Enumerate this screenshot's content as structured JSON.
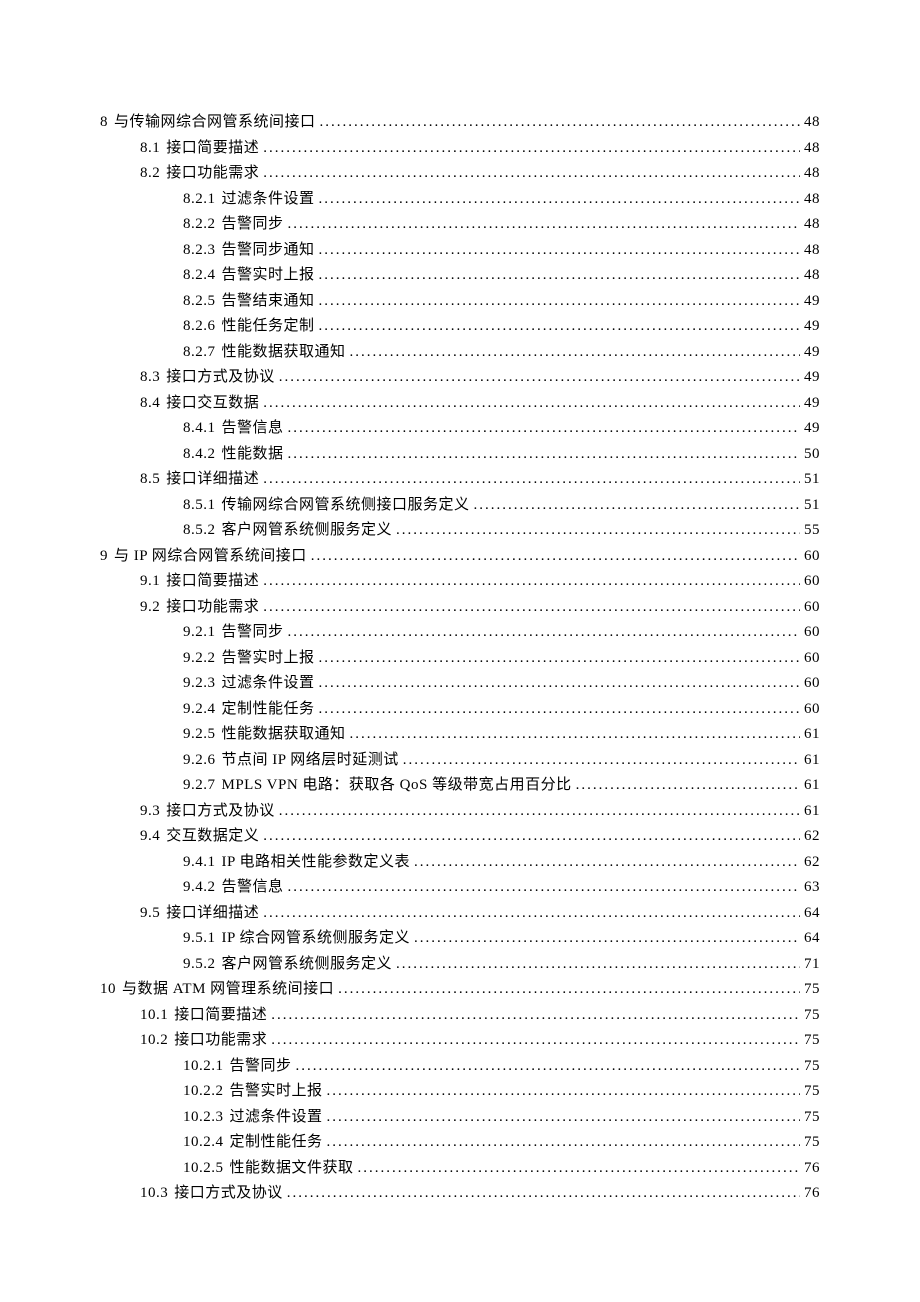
{
  "toc": [
    {
      "level": 0,
      "num": "8",
      "title": "与传输网综合网管系统间接口",
      "page": "48"
    },
    {
      "level": 1,
      "num": "8.1",
      "title": "接口简要描述 ",
      "page": "48"
    },
    {
      "level": 1,
      "num": "8.2",
      "title": "接口功能需求 ",
      "page": "48"
    },
    {
      "level": 2,
      "num": "8.2.1",
      "title": "过滤条件设置",
      "page": "48"
    },
    {
      "level": 2,
      "num": "8.2.2",
      "title": "告警同步",
      "page": "48"
    },
    {
      "level": 2,
      "num": "8.2.3",
      "title": "告警同步通知",
      "page": "48"
    },
    {
      "level": 2,
      "num": "8.2.4",
      "title": "告警实时上报",
      "page": "48"
    },
    {
      "level": 2,
      "num": "8.2.5",
      "title": "告警结束通知",
      "page": "49"
    },
    {
      "level": 2,
      "num": "8.2.6",
      "title": "性能任务定制",
      "page": "49"
    },
    {
      "level": 2,
      "num": "8.2.7",
      "title": "性能数据获取通知",
      "page": "49"
    },
    {
      "level": 1,
      "num": "8.3",
      "title": "接口方式及协议 ",
      "page": "49"
    },
    {
      "level": 1,
      "num": "8.4",
      "title": "接口交互数据 ",
      "page": "49"
    },
    {
      "level": 2,
      "num": "8.4.1",
      "title": "告警信息",
      "page": "49"
    },
    {
      "level": 2,
      "num": "8.4.2",
      "title": "性能数据",
      "page": "50"
    },
    {
      "level": 1,
      "num": "8.5",
      "title": "接口详细描述 ",
      "page": "51"
    },
    {
      "level": 2,
      "num": "8.5.1",
      "title": "传输网综合网管系统侧接口服务定义",
      "page": "51"
    },
    {
      "level": 2,
      "num": "8.5.2",
      "title": "客户网管系统侧服务定义",
      "page": "55"
    },
    {
      "level": 0,
      "num": "9",
      "title": "与 IP 网综合网管系统间接口",
      "page": "60"
    },
    {
      "level": 1,
      "num": "9.1",
      "title": "接口简要描述 ",
      "page": "60"
    },
    {
      "level": 1,
      "num": "9.2",
      "title": "接口功能需求 ",
      "page": "60"
    },
    {
      "level": 2,
      "num": "9.2.1",
      "title": "告警同步",
      "page": "60"
    },
    {
      "level": 2,
      "num": "9.2.2",
      "title": "告警实时上报",
      "page": "60"
    },
    {
      "level": 2,
      "num": "9.2.3",
      "title": "过滤条件设置",
      "page": "60"
    },
    {
      "level": 2,
      "num": "9.2.4",
      "title": "定制性能任务",
      "page": "60"
    },
    {
      "level": 2,
      "num": "9.2.5",
      "title": "性能数据获取通知",
      "page": "61"
    },
    {
      "level": 2,
      "num": "9.2.6",
      "title": "节点间 IP 网络层时延测试",
      "page": "61"
    },
    {
      "level": 2,
      "num": "9.2.7",
      "title": "MPLS VPN 电路：获取各 QoS 等级带宽占用百分比",
      "page": "61"
    },
    {
      "level": 1,
      "num": "9.3",
      "title": "接口方式及协议 ",
      "page": "61"
    },
    {
      "level": 1,
      "num": "9.4",
      "title": "交互数据定义 ",
      "page": "62"
    },
    {
      "level": 2,
      "num": "9.4.1",
      "title": "IP 电路相关性能参数定义表",
      "page": "62"
    },
    {
      "level": 2,
      "num": "9.4.2",
      "title": "告警信息",
      "page": "63"
    },
    {
      "level": 1,
      "num": "9.5",
      "title": "接口详细描述 ",
      "page": "64"
    },
    {
      "level": 2,
      "num": "9.5.1",
      "title": "IP 综合网管系统侧服务定义",
      "page": "64"
    },
    {
      "level": 2,
      "num": "9.5.2",
      "title": "客户网管系统侧服务定义",
      "page": "71"
    },
    {
      "level": 0,
      "num": "10",
      "title": "与数据 ATM 网管理系统间接口",
      "page": "75"
    },
    {
      "level": 1,
      "num": "10.1",
      "title": "接口简要描述 ",
      "page": "75"
    },
    {
      "level": 1,
      "num": "10.2",
      "title": "接口功能需求 ",
      "page": "75"
    },
    {
      "level": 2,
      "num": "10.2.1",
      "title": "告警同步",
      "page": "75"
    },
    {
      "level": 2,
      "num": "10.2.2",
      "title": "告警实时上报",
      "page": "75"
    },
    {
      "level": 2,
      "num": "10.2.3",
      "title": "过滤条件设置",
      "page": "75"
    },
    {
      "level": 2,
      "num": "10.2.4",
      "title": "定制性能任务",
      "page": "75"
    },
    {
      "level": 2,
      "num": "10.2.5",
      "title": "性能数据文件获取",
      "page": "76"
    },
    {
      "level": 1,
      "num": "10.3",
      "title": "接口方式及协议 ",
      "page": "76"
    }
  ]
}
